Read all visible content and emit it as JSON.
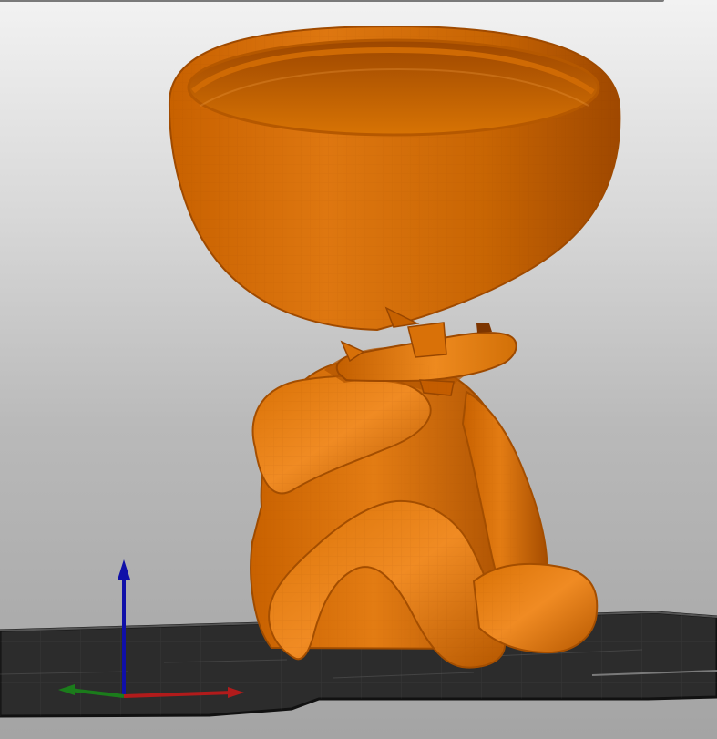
{
  "viewport": {
    "background_top": "#f2f2f2",
    "background_bottom": "#a4a4a4"
  },
  "scene": {
    "object_color": "#d36e0a",
    "object_shadow_color": "#8f4300",
    "object_highlight_color": "#ef8b24",
    "bed_color": "#2a2a2a",
    "bed_edge_color": "#111111",
    "bed_grid_color": "#6c6c6c"
  },
  "axes": {
    "x_color": "#b11b1b",
    "y_color": "#1b7c1b",
    "z_color": "#1010a8",
    "x_icon": "x-axis-arrow",
    "y_icon": "y-axis-arrow",
    "z_icon": "z-axis-arrow"
  }
}
